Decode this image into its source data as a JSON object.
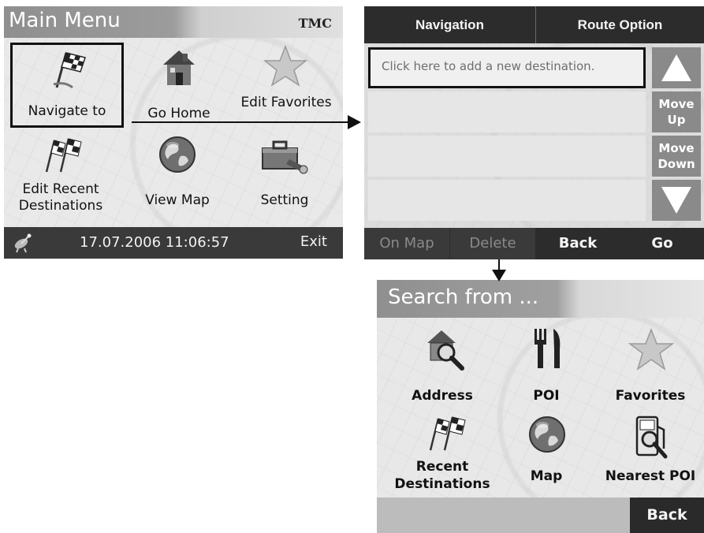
{
  "main_menu": {
    "title": "Main Menu",
    "tmc_label": "TMC",
    "items": [
      {
        "label": "Navigate to",
        "icon": "checkered-flag-icon"
      },
      {
        "label": "Go Home",
        "icon": "house-icon"
      },
      {
        "label": "Edit Favorites",
        "icon": "star-icon"
      },
      {
        "label": "Edit Recent Destinations",
        "icon": "checkered-flags-icon"
      },
      {
        "label": "View Map",
        "icon": "globe-icon"
      },
      {
        "label": "Setting",
        "icon": "toolbox-icon"
      }
    ],
    "status": {
      "satellite_icon": "satellite-icon",
      "datetime": "17.07.2006 11:06:57",
      "exit_label": "Exit"
    }
  },
  "route": {
    "tabs": [
      "Navigation",
      "Route Option"
    ],
    "destinations": [
      "Click here to add a new destination.",
      "",
      "",
      ""
    ],
    "side_buttons": {
      "up_icon": "triangle-up-icon",
      "move_up": "Move Up",
      "move_down": "Move Down",
      "down_icon": "triangle-down-icon"
    },
    "bottom_buttons": [
      "On Map",
      "Delete",
      "Back",
      "Go"
    ]
  },
  "search": {
    "title": "Search from ...",
    "items": [
      {
        "label": "Address",
        "icon": "house-magnifier-icon"
      },
      {
        "label": "POI",
        "icon": "fork-knife-icon"
      },
      {
        "label": "Favorites",
        "icon": "star-icon"
      },
      {
        "label": "Recent Destinations",
        "icon": "checkered-flags-icon"
      },
      {
        "label": "Map",
        "icon": "globe-icon"
      },
      {
        "label": "Nearest POI",
        "icon": "fuel-pump-magnifier-icon"
      }
    ],
    "back_label": "Back"
  },
  "colors": {
    "dark_bar": "#2c2c2c",
    "side_button": "#8a8a8a",
    "panel": "#e8e8e8",
    "title_gray": "#9c9c9c"
  }
}
